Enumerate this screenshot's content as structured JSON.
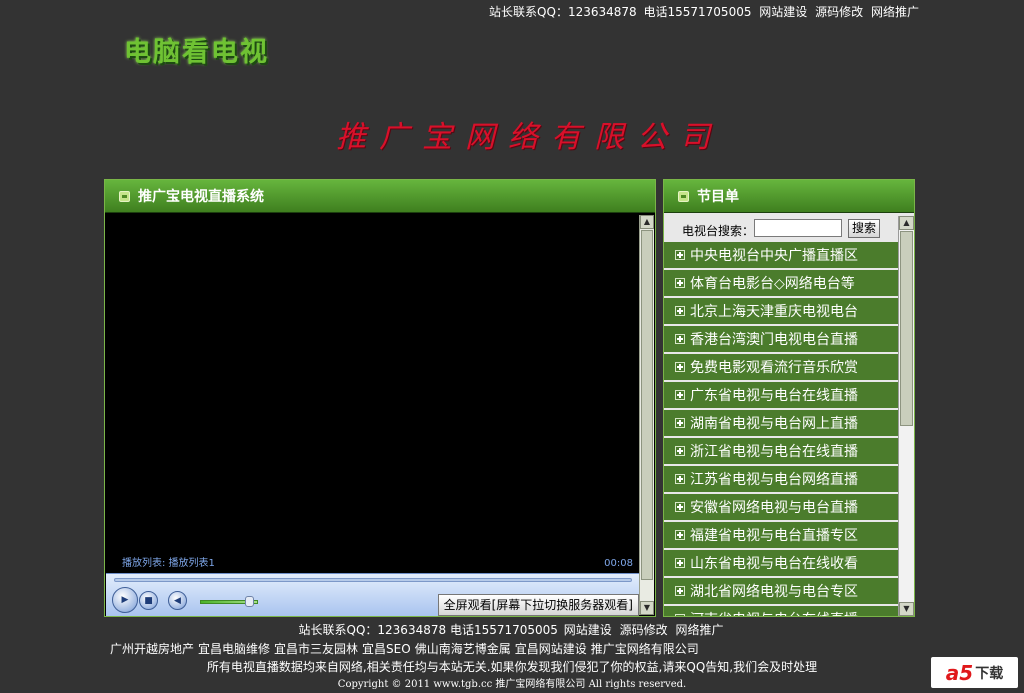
{
  "top_bar": {
    "contact": "站长联系QQ：123634878",
    "phone": "电话15571705005",
    "links": [
      "网站建设",
      "源码修改",
      "网络推广"
    ]
  },
  "logo_text": "电脑看电视",
  "banner_text": "推广宝网络有限公司",
  "player": {
    "title": "推广宝电视直播系统",
    "playlist": "播放列表: 播放列表1",
    "time": "00:08",
    "fullscreen_label": "全屏观看[屏幕下拉切换服务器观看]",
    "volume_fraction": 0.85
  },
  "program": {
    "title": "节目单",
    "search_label": "电视台搜索：",
    "search_value": "",
    "search_button": "搜索",
    "channels": [
      "中央电视台中央广播直播区",
      "体育台电影台◇网络电台等",
      "北京上海天津重庆电视电台",
      "香港台湾澳门电视电台直播",
      "免费电影观看流行音乐欣赏",
      "广东省电视与电台在线直播",
      "湖南省电视与电台网上直播",
      "浙江省电视与电台在线直播",
      "江苏省电视与电台网络直播",
      "安徽省网络电视与电台直播",
      "福建省电视与电台直播专区",
      "山东省电视与电台在线收看",
      "湖北省网络电视与电台专区",
      "河南省电视与电台在线直播"
    ]
  },
  "footer": {
    "contact": "站长联系QQ：123634878",
    "phone": "电话15571705005",
    "links": [
      "网站建设",
      "源码修改",
      "网络推广"
    ],
    "friend_links": [
      "广州开越房地产",
      "宜昌电脑维修",
      "宜昌市三友园林",
      "宜昌SEO",
      "佛山南海艺博金属",
      "宜昌网站建设",
      "推广宝网络有限公司"
    ],
    "disclaimer": "所有电视直播数据均来自网络,相关责任均与本站无关.如果你发现我们侵犯了你的权益,请来QQ告知,我们会及时处理",
    "copyright": "Copyright © 2011 www.tgb.cc 推广宝网络有限公司 All rights reserved."
  },
  "watermark": {
    "brand": "a5",
    "text": "下载"
  }
}
